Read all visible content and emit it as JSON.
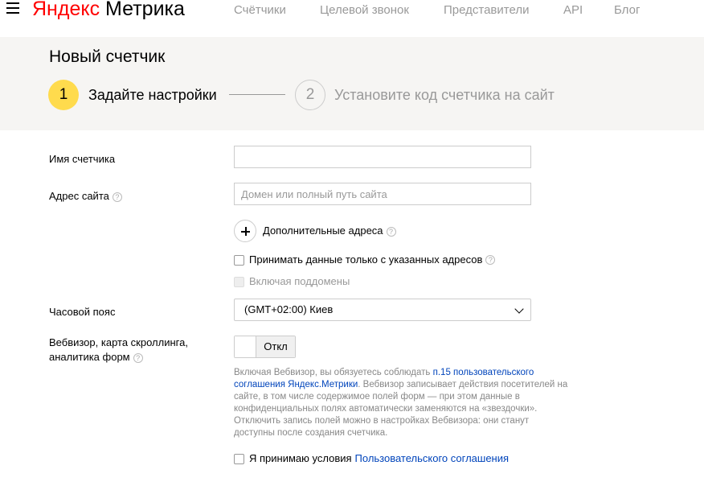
{
  "header": {
    "logo_brand": "Яндекс",
    "logo_product": "Метрика",
    "nav": [
      {
        "label": "Счётчики"
      },
      {
        "label": "Целевой звонок"
      },
      {
        "label": "Представители"
      },
      {
        "label": "API"
      },
      {
        "label": "Блог"
      }
    ]
  },
  "steps": {
    "title": "Новый счетчик",
    "step1_number": "1",
    "step1_label": "Задайте настройки",
    "step2_number": "2",
    "step2_label": "Установите код счетчика на сайт"
  },
  "form": {
    "counter_name_label": "Имя счетчика",
    "counter_name_value": "",
    "site_address_label": "Адрес сайта",
    "site_address_placeholder": "Домен или полный путь сайта",
    "additional_addresses_label": "Дополнительные адреса",
    "only_listed_label": "Принимать данные только с указанных адресов",
    "include_subdomains_label": "Включая поддомены",
    "timezone_label": "Часовой пояс",
    "timezone_value": "(GMT+02:00) Киев",
    "webvisor_label_line1": "Вебвизор, карта скроллинга,",
    "webvisor_label_line2": "аналитика форм",
    "webvisor_toggle_state": "Откл",
    "webvisor_notice_before": "Включая Вебвизор, вы обязуетесь соблюдать ",
    "webvisor_notice_link": "п.15 пользовательского соглашения Яндекс.Метрики",
    "webvisor_notice_after": ". Вебвизор записывает действия посетителей на сайте, в том числе содержимое полей форм — при этом данные в конфиденциальных полях автоматически заменяются на «звездочки». Отключить запись полей можно в настройках Вебвизора: они станут доступны после создания счетчика.",
    "agree_text": "Я принимаю условия",
    "agree_link": "Пользовательского соглашения"
  },
  "icons": {
    "help": "?"
  }
}
